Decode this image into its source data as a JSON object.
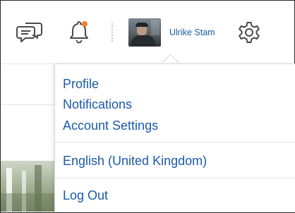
{
  "header": {
    "chat_icon": "chat-bubbles-icon",
    "bell_icon": "bell-icon",
    "notification_dot_color": "#f47e2b",
    "user_name": "Ulrike Stam",
    "settings_icon": "gear-icon"
  },
  "menu": {
    "items": [
      {
        "label": "Profile"
      },
      {
        "label": "Notifications"
      },
      {
        "label": "Account Settings"
      },
      {
        "label": "English (United Kingdom)"
      },
      {
        "label": "Log Out"
      }
    ]
  },
  "colors": {
    "link": "#1b5aa6",
    "text_icon": "#4a4a4a"
  }
}
